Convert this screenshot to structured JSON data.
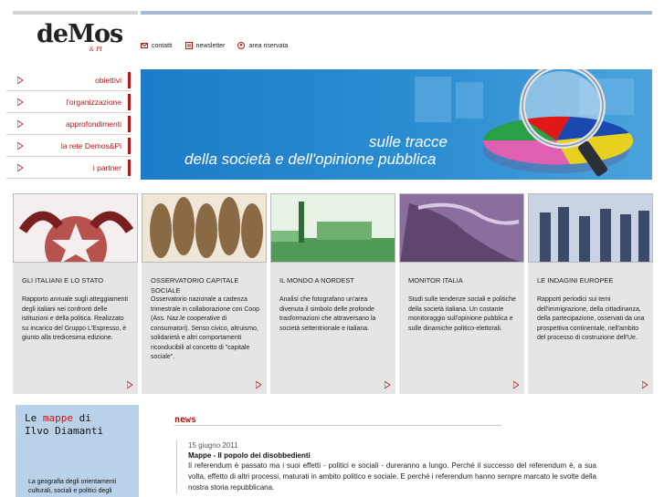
{
  "logo": {
    "main": "deMos",
    "sub": "& PI"
  },
  "toplinks": [
    {
      "label": "contatti",
      "icon": "mail-icon"
    },
    {
      "label": "newsletter",
      "icon": "newsletter-icon"
    },
    {
      "label": "area riservata",
      "icon": "user-icon"
    }
  ],
  "nav": [
    {
      "label": "obiettivi"
    },
    {
      "label": "l'organizzazione"
    },
    {
      "label": "approfondimenti"
    },
    {
      "label": "la rete Demos&Pi"
    },
    {
      "label": "i partner"
    }
  ],
  "banner": {
    "line1": "sulle tracce",
    "line2": "della società e dell'opinione pubblica"
  },
  "cards": [
    {
      "title": "GLI ITALIANI E LO STATO",
      "body": "Rapporto annuale sugli atteggiamenti degli italiani nei confronti delle istituzioni e della politica. Realizzato su incarico del Gruppo L'Espresso, è giunto alla tredicesima edizione."
    },
    {
      "title": "OSSERVATORIO CAPITALE SOCIALE",
      "body": "Osservatorio nazionale a cadenza trimestrale in collaborazione con Coop (Ass. Naz.le cooperative di consumatori). Senso civico, altruismo, solidarietà e altri comportamenti riconducibili al concetto di \"capitale sociale\"."
    },
    {
      "title": "IL MONDO A NORDEST",
      "body": "Analisi che fotografano un'area divenuta il simbolo delle profonde trasformazioni che attraversano la società settentrionale e italiana."
    },
    {
      "title": "MONITOR ITALIA",
      "body": "Studi sulle tendenze sociali e politiche della società italiana. Un costante monitoraggio sull'opinione pubblica e sulle dinamiche politico-elettorali."
    },
    {
      "title": "LE INDAGINI EUROPEE",
      "body": "Rapporti periodici sui temi dell'immigrazione, della cittadinanza, della partecipazione, osservati da una prospettiva continentale, nell'ambito del processo di costruzione dell'Ue."
    }
  ],
  "mappe": {
    "pre": "Le ",
    "highlight": "mappe",
    "post": " di",
    "author": "Ilvo Diamanti",
    "text": "La geografia degli orientamenti culturali, sociali e politici degli"
  },
  "news": {
    "heading": "news",
    "date": "15 giugno 2011",
    "title": "Mappe - Il popolo dei disobbedienti",
    "text": "Il referendum è passato ma i suoi effetti - politici e sociali - dureranno a lungo. Perché il successo del referendum è, a sua volta, effetto di altri processi, maturati in ambito politico e sociale. E perché i referendum hanno sempre marcato le svolte della nostra storia repubblicana."
  },
  "colors": {
    "accent": "#b01818",
    "banner_blue": "#1f7fc8",
    "card_bg": "#e5e5e5",
    "mappe_bg": "#b9d2e9"
  }
}
